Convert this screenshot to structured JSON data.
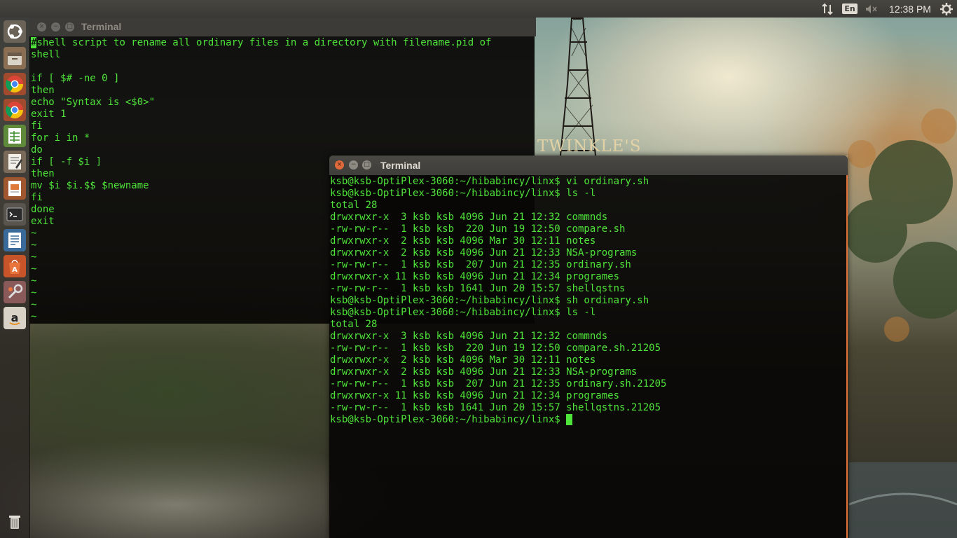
{
  "top_panel": {
    "clock": "12:38 PM",
    "keyboard_layout": "En",
    "icons": [
      "network-arrows-icon",
      "volume-muted-icon",
      "gear-icon"
    ]
  },
  "wallpaper": {
    "text": "TWINKLE'S"
  },
  "launcher": {
    "items": [
      "dash-ubuntu-icon",
      "files-icon",
      "chrome-icon",
      "chrome-icon",
      "spreadsheet-icon",
      "text-editor-icon",
      "presentation-icon",
      "terminal-icon",
      "document-icon",
      "software-center-icon",
      "settings-icon",
      "amazon-icon",
      "trash-icon"
    ]
  },
  "terminal1": {
    "title": "Terminal",
    "lines": [
      "#shell script to rename all ordinary files in a directory with filename.pid of",
      "shell",
      "",
      "if [ $# -ne 0 ]",
      "then",
      "echo \"Syntax is <$0>\"",
      "exit 1",
      "fi",
      "for i in *",
      "do",
      "if [ -f $i ]",
      "then",
      "mv $i $i.$$ $newname",
      "fi",
      "done",
      "exit",
      "~",
      "~",
      "~",
      "~",
      "~",
      "~",
      "~",
      "~"
    ]
  },
  "terminal2": {
    "title": "Terminal",
    "lines": [
      "ksb@ksb-OptiPlex-3060:~/hibabincy/linx$ vi ordinary.sh",
      "ksb@ksb-OptiPlex-3060:~/hibabincy/linx$ ls -l",
      "total 28",
      "drwxrwxr-x  3 ksb ksb 4096 Jun 21 12:32 commnds",
      "-rw-rw-r--  1 ksb ksb  220 Jun 19 12:50 compare.sh",
      "drwxrwxr-x  2 ksb ksb 4096 Mar 30 12:11 notes",
      "drwxrwxr-x  2 ksb ksb 4096 Jun 21 12:33 NSA-programs",
      "-rw-rw-r--  1 ksb ksb  207 Jun 21 12:35 ordinary.sh",
      "drwxrwxr-x 11 ksb ksb 4096 Jun 21 12:34 programes",
      "-rw-rw-r--  1 ksb ksb 1641 Jun 20 15:57 shellqstns",
      "ksb@ksb-OptiPlex-3060:~/hibabincy/linx$ sh ordinary.sh",
      "ksb@ksb-OptiPlex-3060:~/hibabincy/linx$ ls -l",
      "total 28",
      "drwxrwxr-x  3 ksb ksb 4096 Jun 21 12:32 commnds",
      "-rw-rw-r--  1 ksb ksb  220 Jun 19 12:50 compare.sh.21205",
      "drwxrwxr-x  2 ksb ksb 4096 Mar 30 12:11 notes",
      "drwxrwxr-x  2 ksb ksb 4096 Jun 21 12:33 NSA-programs",
      "-rw-rw-r--  1 ksb ksb  207 Jun 21 12:35 ordinary.sh.21205",
      "drwxrwxr-x 11 ksb ksb 4096 Jun 21 12:34 programes",
      "-rw-rw-r--  1 ksb ksb 1641 Jun 20 15:57 shellqstns.21205"
    ],
    "prompt": "ksb@ksb-OptiPlex-3060:~/hibabincy/linx$ "
  },
  "colors": {
    "terminal_text": "#4fe43a",
    "close_button": "#e0693b",
    "focus_border": "#e0723a"
  }
}
